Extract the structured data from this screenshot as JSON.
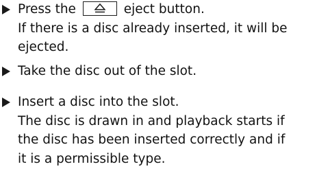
{
  "steps": [
    {
      "action_before_key": "Press the",
      "key_icon": "eject-icon",
      "action_after_key": "eject button.",
      "result_lines": [
        "If there is a disc already inserted, it will be",
        "ejected."
      ]
    },
    {
      "action": "Take the disc out of the slot."
    },
    {
      "action": "Insert a disc into the slot.",
      "result_lines": [
        "The disc is drawn in and playback starts if",
        "the disc has been inserted correctly and if",
        "it is a permissible type."
      ]
    }
  ]
}
